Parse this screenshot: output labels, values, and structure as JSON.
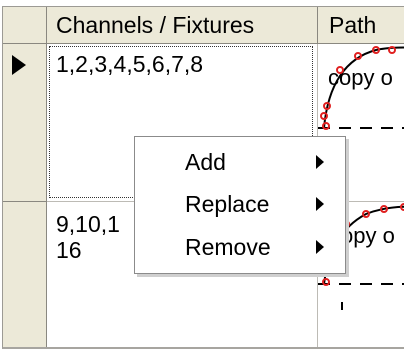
{
  "grid": {
    "columns": [
      "Channels / Fixtures",
      "Path"
    ],
    "rows": [
      {
        "channels": [
          "1,2,3,4,5,6,7,8"
        ],
        "path_text": "copy o",
        "selected": true
      },
      {
        "channels": [
          "9,10,1",
          "16"
        ],
        "path_text": "copy o",
        "selected": false
      }
    ]
  },
  "context_menu": {
    "items": [
      {
        "label": "Add",
        "icon": "submenu-arrow-icon"
      },
      {
        "label": "Replace",
        "icon": "submenu-arrow-icon"
      },
      {
        "label": "Remove",
        "icon": "submenu-arrow-icon"
      }
    ]
  },
  "colors": {
    "header_bg": "#ece9d8",
    "path_curve": "#e02020",
    "menu_bg": "#ffffff",
    "grid_line": "#bdbbb5"
  }
}
